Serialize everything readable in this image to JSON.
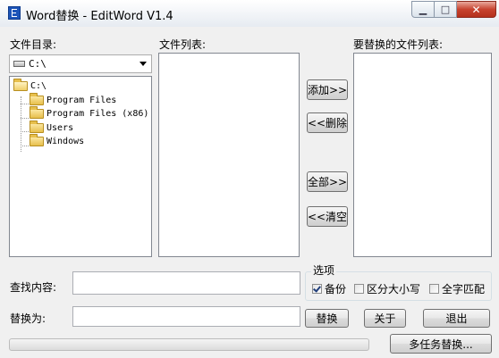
{
  "window": {
    "title": "Word替换 - EditWord V1.4",
    "min_glyph": "▁",
    "max_glyph": "□",
    "close_glyph": "✕"
  },
  "labels": {
    "file_dir": "文件目录:",
    "file_list": "文件列表:",
    "replace_list": "要替换的文件列表:",
    "find": "查找内容:",
    "replace_with": "替换为:"
  },
  "drive_combo": {
    "value": "C:\\"
  },
  "tree": {
    "root": "C:\\",
    "children": [
      "Program Files",
      "Program Files (x86)",
      "Users",
      "Windows"
    ]
  },
  "buttons": {
    "add": "添加>>",
    "delete": "<<删除",
    "all": "全部>>",
    "clear": "<<清空",
    "replace": "替换",
    "about": "关于",
    "exit": "退出",
    "multi_task": "多任务替换..."
  },
  "inputs": {
    "find_value": "",
    "replace_value": ""
  },
  "options": {
    "title": "选项",
    "backup": {
      "label": "备份",
      "checked": true
    },
    "case_sensitive": {
      "label": "区分大小写",
      "checked": false
    },
    "whole_word": {
      "label": "全字匹配",
      "checked": false
    }
  },
  "progress": {
    "value": 0
  },
  "colors": {
    "background": "#f0f0f0",
    "app_icon": "#1c54b8",
    "close_button": "#c7432f",
    "progress_fill": "#37b42e"
  }
}
